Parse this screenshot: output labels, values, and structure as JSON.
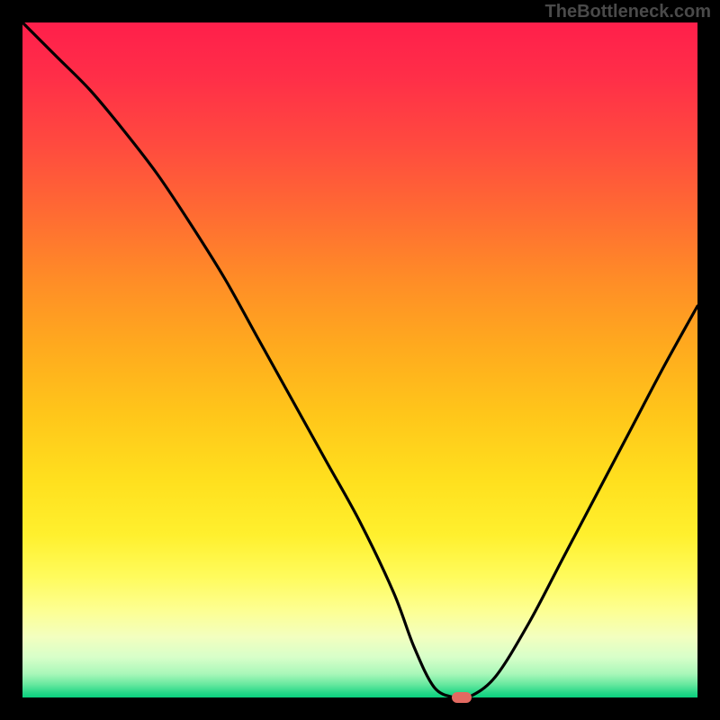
{
  "attribution": "TheBottleneck.com",
  "colors": {
    "frame": "#000000",
    "marker": "#e36a61",
    "curve": "#000000"
  },
  "chart_data": {
    "type": "line",
    "title": "",
    "xlabel": "",
    "ylabel": "",
    "xlim": [
      0,
      100
    ],
    "ylim": [
      0,
      100
    ],
    "x": [
      0,
      5,
      10,
      15,
      20,
      25,
      30,
      35,
      40,
      45,
      50,
      55,
      58,
      61,
      64,
      66,
      70,
      75,
      80,
      85,
      90,
      95,
      100
    ],
    "values": [
      100,
      95,
      90,
      84,
      77.5,
      70,
      62,
      53,
      44,
      35,
      26,
      15.5,
      7.5,
      1.5,
      0,
      0,
      3,
      11,
      20.5,
      30,
      39.5,
      49,
      58
    ],
    "background_gradient": [
      {
        "pos": 0.0,
        "color": "#ff1f4b"
      },
      {
        "pos": 0.5,
        "color": "#ffc61a"
      },
      {
        "pos": 0.82,
        "color": "#fffb5b"
      },
      {
        "pos": 1.0,
        "color": "#09d07e"
      }
    ],
    "marker": {
      "x": 65,
      "y": 0
    },
    "grid": false,
    "legend": false
  }
}
